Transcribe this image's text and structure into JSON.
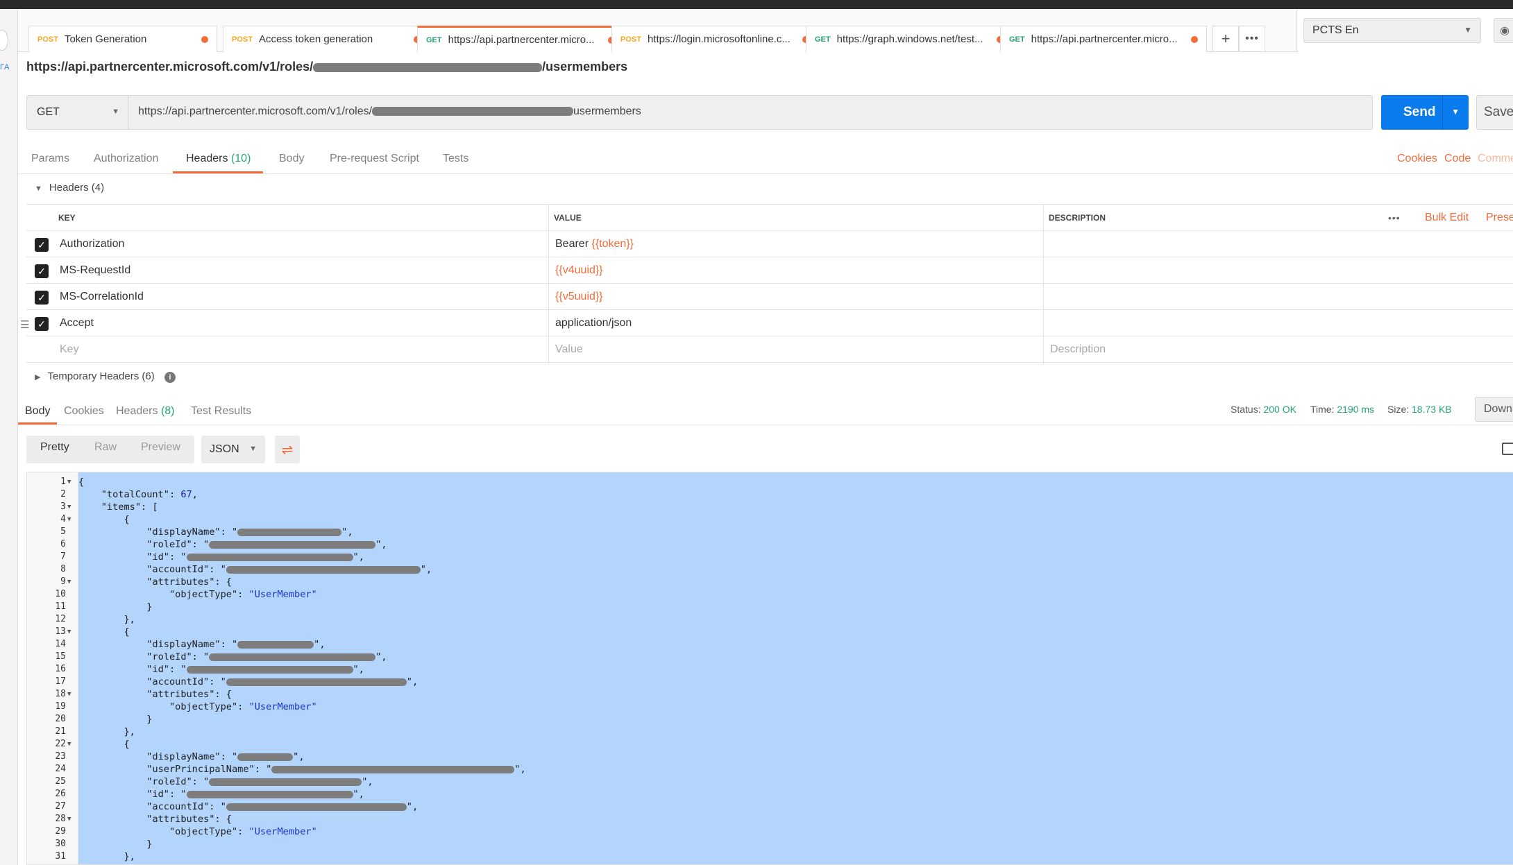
{
  "tabs": [
    {
      "method": "POST",
      "title": "Token Generation"
    },
    {
      "method": "POST",
      "title": "Access token generation"
    },
    {
      "method": "GET",
      "title": "https://api.partnercenter.micro..."
    },
    {
      "method": "POST",
      "title": "https://login.microsoftonline.c..."
    },
    {
      "method": "GET",
      "title": "https://graph.windows.net/test..."
    },
    {
      "method": "GET",
      "title": "https://api.partnercenter.micro..."
    }
  ],
  "environment": "PCTS En",
  "left_edge_text": "ΓA",
  "request_name_prefix": "https://api.partnercenter.microsoft.com/v1/roles/",
  "request_name_suffix": "/usermembers",
  "method": "GET",
  "url_prefix": "https://api.partnercenter.microsoft.com/v1/roles/",
  "url_suffix": "usermembers",
  "send_label": "Send",
  "save_label": "Save",
  "request_tabs": {
    "params": "Params",
    "authorization": "Authorization",
    "headers": "Headers",
    "headers_count": "(10)",
    "body": "Body",
    "prerequest": "Pre-request Script",
    "tests": "Tests"
  },
  "right_links": {
    "cookies": "Cookies",
    "code": "Code",
    "comments": "Comme"
  },
  "headers_section": {
    "title": "Headers",
    "count": "(4)"
  },
  "columns": {
    "key": "KEY",
    "value": "VALUE",
    "description": "DESCRIPTION"
  },
  "table_actions": {
    "bulk_edit": "Bulk Edit",
    "presets": "Prese"
  },
  "headers": [
    {
      "key": "Authorization",
      "value_prefix": "Bearer ",
      "value_var": "{{token}}"
    },
    {
      "key": "MS-RequestId",
      "value_prefix": "",
      "value_var": "{{v4uuid}}"
    },
    {
      "key": "MS-CorrelationId",
      "value_prefix": "",
      "value_var": "{{v5uuid}}"
    },
    {
      "key": "Accept",
      "value_prefix": "application/json",
      "value_var": ""
    }
  ],
  "placeholders": {
    "key": "Key",
    "value": "Value",
    "description": "Description"
  },
  "temp_headers": {
    "title": "Temporary Headers",
    "count": "(6)"
  },
  "response_tabs": {
    "body": "Body",
    "cookies": "Cookies",
    "headers": "Headers",
    "headers_count": "(8)",
    "test_results": "Test Results"
  },
  "status": {
    "status_label": "Status:",
    "status_value": "200 OK",
    "time_label": "Time:",
    "time_value": "2190 ms",
    "size_label": "Size:",
    "size_value": "18.73 KB"
  },
  "download_label": "Downl",
  "view_modes": {
    "pretty": "Pretty",
    "raw": "Raw",
    "preview": "Preview"
  },
  "format": "JSON",
  "code_lines": [
    "{",
    "    \"totalCount\": 67,",
    "    \"items\": [",
    "        {",
    "            \"displayName\": \"",
    "            \"roleId\": \"",
    "            \"id\": \"",
    "            \"accountId\": \"",
    "            \"attributes\": {",
    "                \"objectType\": \"UserMember\"",
    "            }",
    "        },",
    "        {",
    "            \"displayName\": \"",
    "            \"roleId\": \"",
    "            \"id\": \"",
    "            \"accountId\": \"",
    "            \"attributes\": {",
    "                \"objectType\": \"UserMember\"",
    "            }",
    "        },",
    "        {",
    "            \"displayName\": \"",
    "            \"userPrincipalName\": \"",
    "            \"roleId\": \"",
    "            \"id\": \"",
    "            \"accountId\": \"",
    "            \"attributes\": {",
    "                \"objectType\": \"UserMember\"",
    "            }",
    "        },",
    "        {"
  ]
}
